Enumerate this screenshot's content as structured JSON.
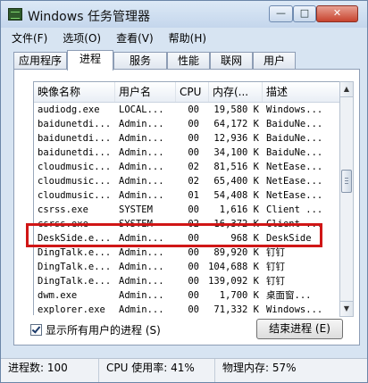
{
  "window": {
    "title": "Windows 任务管理器",
    "minimize_label": "—",
    "maximize_label": "□",
    "close_label": "✕"
  },
  "menu": [
    "文件(F)",
    "选项(O)",
    "查看(V)",
    "帮助(H)"
  ],
  "tabs": [
    {
      "label": "应用程序",
      "active": false
    },
    {
      "label": "进程",
      "active": true
    },
    {
      "label": "服务",
      "active": false
    },
    {
      "label": "性能",
      "active": false
    },
    {
      "label": "联网",
      "active": false
    },
    {
      "label": "用户",
      "active": false
    }
  ],
  "columns": [
    "映像名称",
    "用户名",
    "CPU",
    "内存(...",
    "描述"
  ],
  "processes": [
    {
      "name": "audiodg.exe",
      "user": "LOCAL...",
      "cpu": "00",
      "mem": "19,580 K",
      "desc": "Windows..."
    },
    {
      "name": "baidunetdi...",
      "user": "Admin...",
      "cpu": "00",
      "mem": "64,172 K",
      "desc": "BaiduNe..."
    },
    {
      "name": "baidunetdi...",
      "user": "Admin...",
      "cpu": "00",
      "mem": "12,936 K",
      "desc": "BaiduNe..."
    },
    {
      "name": "baidunetdi...",
      "user": "Admin...",
      "cpu": "00",
      "mem": "34,100 K",
      "desc": "BaiduNe..."
    },
    {
      "name": "cloudmusic...",
      "user": "Admin...",
      "cpu": "02",
      "mem": "81,516 K",
      "desc": "NetEase..."
    },
    {
      "name": "cloudmusic...",
      "user": "Admin...",
      "cpu": "02",
      "mem": "65,400 K",
      "desc": "NetEase..."
    },
    {
      "name": "cloudmusic...",
      "user": "Admin...",
      "cpu": "01",
      "mem": "54,408 K",
      "desc": "NetEase..."
    },
    {
      "name": "csrss.exe",
      "user": "SYSTEM",
      "cpu": "00",
      "mem": "1,616 K",
      "desc": "Client ..."
    },
    {
      "name": "csrss.exe",
      "user": "SYSTEM",
      "cpu": "02",
      "mem": "16,372 K",
      "desc": "Client ..."
    },
    {
      "name": "DeskSide.e...",
      "user": "Admin...",
      "cpu": "00",
      "mem": "968 K",
      "desc": "DeskSide"
    },
    {
      "name": "DingTalk.e...",
      "user": "Admin...",
      "cpu": "00",
      "mem": "89,920 K",
      "desc": "钉钉"
    },
    {
      "name": "DingTalk.e...",
      "user": "Admin...",
      "cpu": "00",
      "mem": "104,688 K",
      "desc": "钉钉"
    },
    {
      "name": "DingTalk.e...",
      "user": "Admin...",
      "cpu": "00",
      "mem": "139,092 K",
      "desc": "钉钉"
    },
    {
      "name": "dwm.exe",
      "user": "Admin...",
      "cpu": "00",
      "mem": "1,700 K",
      "desc": "桌面窗..."
    },
    {
      "name": "explorer.exe",
      "user": "Admin...",
      "cpu": "00",
      "mem": "71,332 K",
      "desc": "Windows..."
    }
  ],
  "show_all_users_label": "显示所有用户的进程 (S)",
  "show_all_users_checked": true,
  "end_process_label": "结束进程 (E)",
  "status": {
    "process_count": "进程数: 100",
    "cpu_usage": "CPU 使用率: 41%",
    "physical_memory": "物理内存: 57%"
  },
  "colors": {
    "highlight_box": "#d01616",
    "titlebar": "#c4d6ec",
    "close_button": "#c7432e"
  }
}
